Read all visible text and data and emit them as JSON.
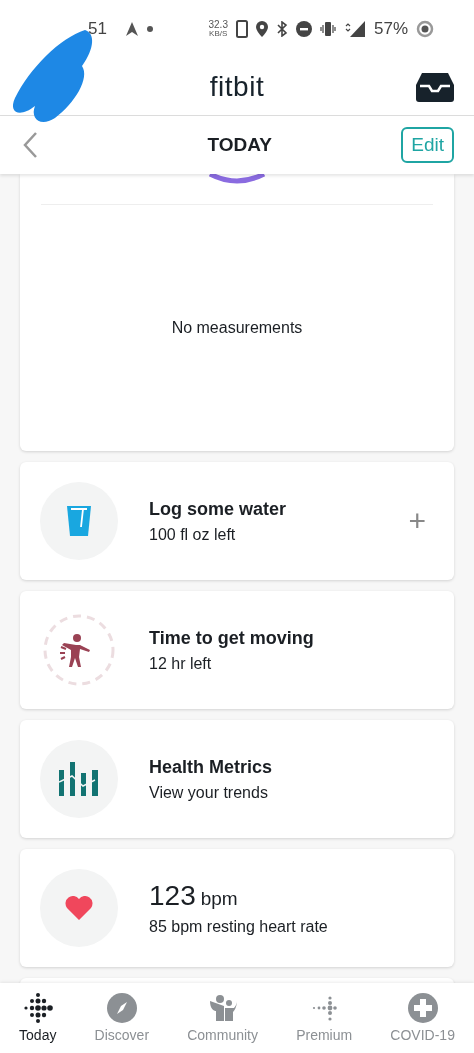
{
  "status_bar": {
    "time": "51",
    "speed": "32.3",
    "speed_unit": "KB/S",
    "battery": "57%"
  },
  "header": {
    "logo": "fitbit"
  },
  "nav_bar": {
    "title": "TODAY",
    "edit_button": "Edit"
  },
  "measurements_card": {
    "message": "No measurements"
  },
  "cards": [
    {
      "kind": "water",
      "title": "Log some water",
      "subtitle": "100 fl oz left",
      "add_button": "+"
    },
    {
      "kind": "activity",
      "title": "Time to get moving",
      "subtitle": "12 hr left"
    },
    {
      "kind": "metrics",
      "title": "Health Metrics",
      "subtitle": "View your trends"
    },
    {
      "kind": "heart",
      "value": "123",
      "unit": "bpm",
      "subtitle": "85 bpm resting heart rate"
    }
  ],
  "tab_bar": [
    {
      "kind": "today",
      "label": "Today",
      "selected": true
    },
    {
      "kind": "discover",
      "label": "Discover",
      "selected": false
    },
    {
      "kind": "community",
      "label": "Community",
      "selected": false
    },
    {
      "kind": "premium",
      "label": "Premium",
      "selected": false
    },
    {
      "kind": "covid",
      "label": "COVID-19",
      "selected": false
    }
  ]
}
